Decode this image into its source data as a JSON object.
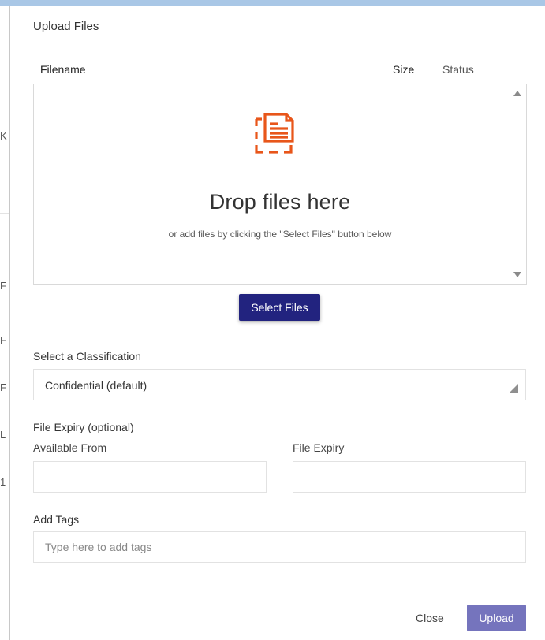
{
  "dialog": {
    "title": "Upload Files"
  },
  "file_table": {
    "columns": [
      "Filename",
      "Size",
      "Status"
    ]
  },
  "dropzone": {
    "icon": "document-upload-icon",
    "title": "Drop files here",
    "subtitle": "or add files by clicking the \"Select Files\" button below"
  },
  "select_files": {
    "label": "Select Files"
  },
  "classification": {
    "label": "Select a Classification",
    "value": "Confidential (default)"
  },
  "expiry": {
    "label": "File Expiry (optional)",
    "available_from_label": "Available From",
    "file_expiry_label": "File Expiry",
    "available_from_value": "",
    "file_expiry_value": ""
  },
  "tags": {
    "label": "Add Tags",
    "placeholder": "Type here to add tags"
  },
  "footer": {
    "close_label": "Close",
    "upload_label": "Upload"
  },
  "background_fragments": [
    "K",
    "F",
    "F",
    "F",
    "L",
    "1"
  ],
  "colors": {
    "primary_button": "#22237f",
    "upload_button": "#7574bd",
    "dropzone_icon": "#e8561a",
    "top_strip": "#a9c7e6"
  }
}
